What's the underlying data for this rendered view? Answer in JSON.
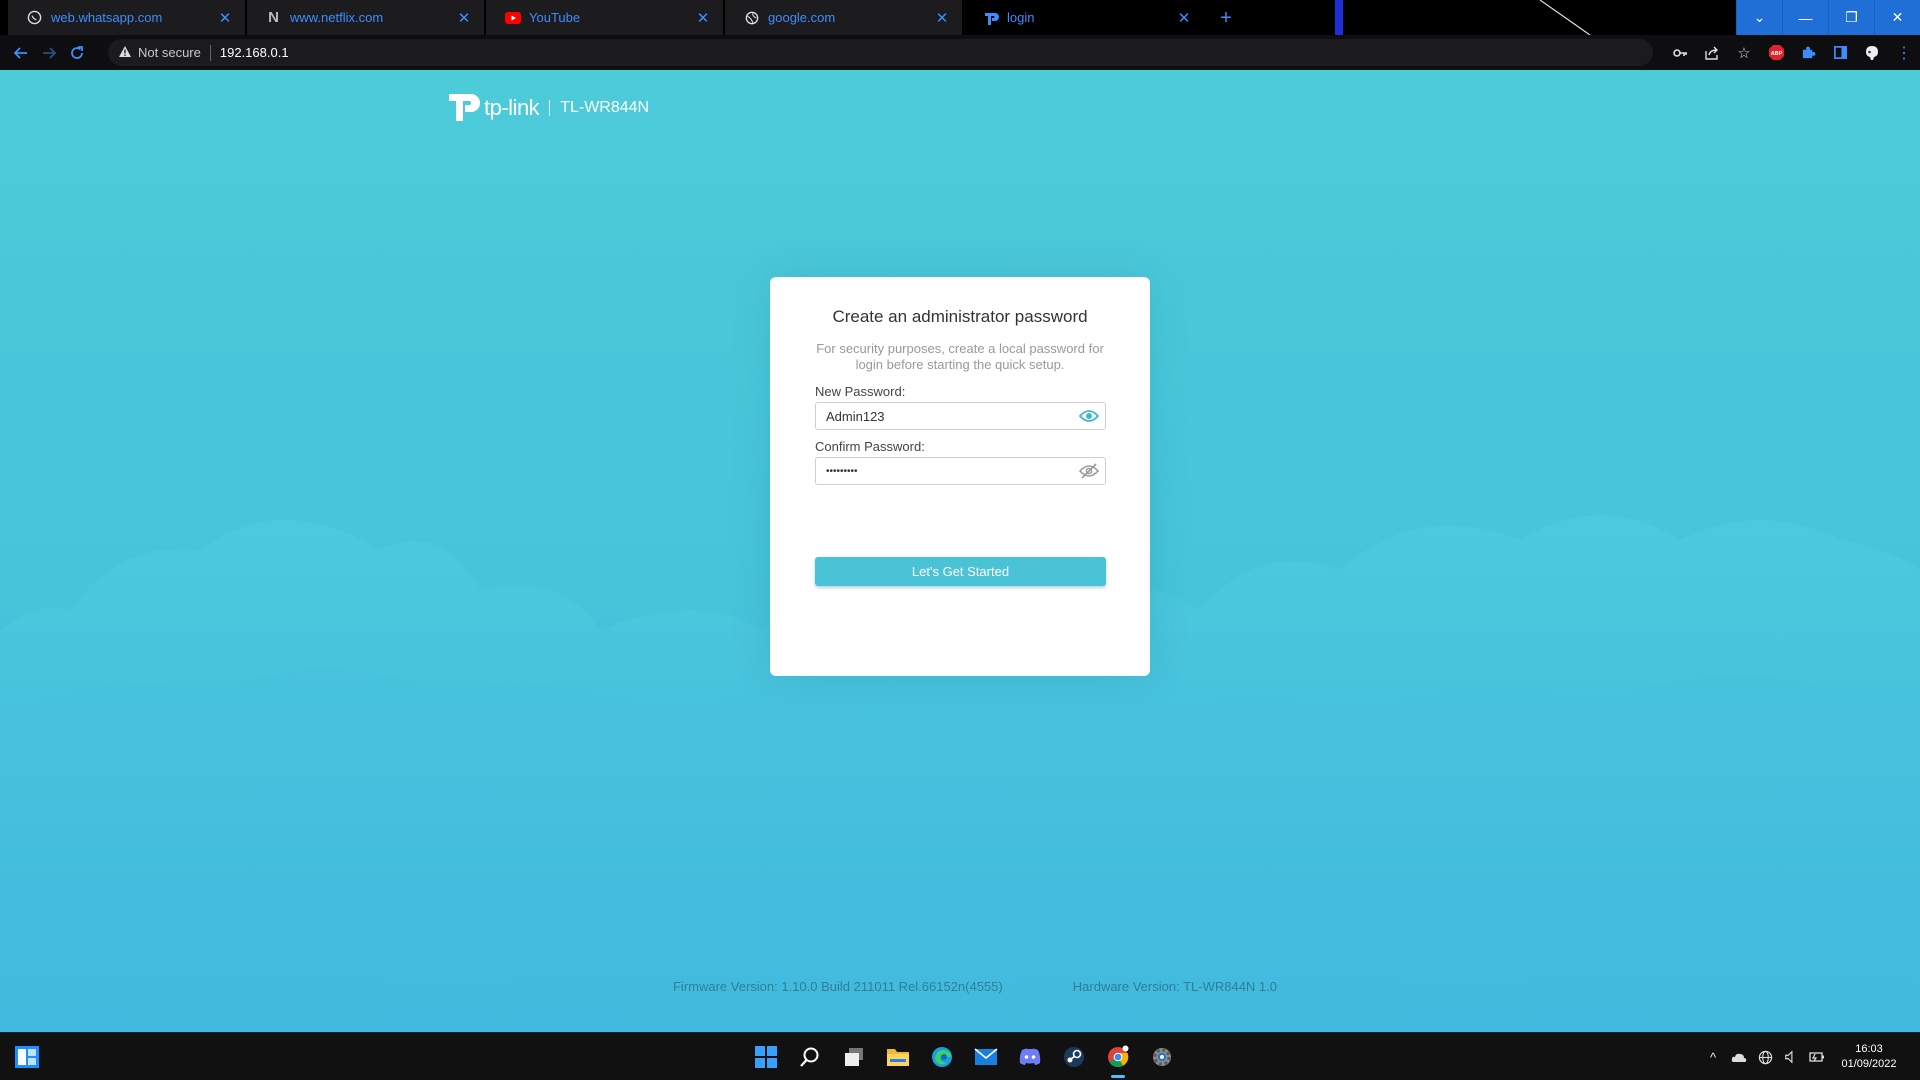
{
  "browser": {
    "tabs": [
      {
        "title": "web.whatsapp.com",
        "icon": "whatsapp-icon",
        "active": false
      },
      {
        "title": "www.netflix.com",
        "icon": "netflix-icon",
        "active": false
      },
      {
        "title": "YouTube",
        "icon": "youtube-icon",
        "active": false
      },
      {
        "title": "google.com",
        "icon": "globe-icon",
        "active": false
      },
      {
        "title": "login",
        "icon": "tplink-icon",
        "active": true
      }
    ],
    "security_label": "Not secure",
    "url": "192.168.0.1",
    "accent": "#3f8cff"
  },
  "router": {
    "brand": "tp-link",
    "model": "TL-WR844N"
  },
  "card": {
    "title": "Create an administrator password",
    "subtitle": "For security purposes, create a local password for login before starting the quick setup.",
    "new_password_label": "New Password:",
    "new_password_value": "Admin123",
    "confirm_password_label": "Confirm Password:",
    "confirm_password_value": "•••••••••",
    "button_label": "Let's Get Started",
    "accent": "#4bc3d6"
  },
  "footer": {
    "firmware": "Firmware Version: 1.10.0 Build 211011 Rel.66152n(4555)",
    "hardware": "Hardware Version: TL-WR844N 1.0"
  },
  "taskbar": {
    "time": "16:03",
    "date": "01/09/2022",
    "apps": [
      "windows-start-icon",
      "search-icon",
      "task-view-icon",
      "file-explorer-icon",
      "edge-icon",
      "mail-icon",
      "discord-icon",
      "steam-icon",
      "chrome-icon",
      "settings-icon"
    ]
  }
}
